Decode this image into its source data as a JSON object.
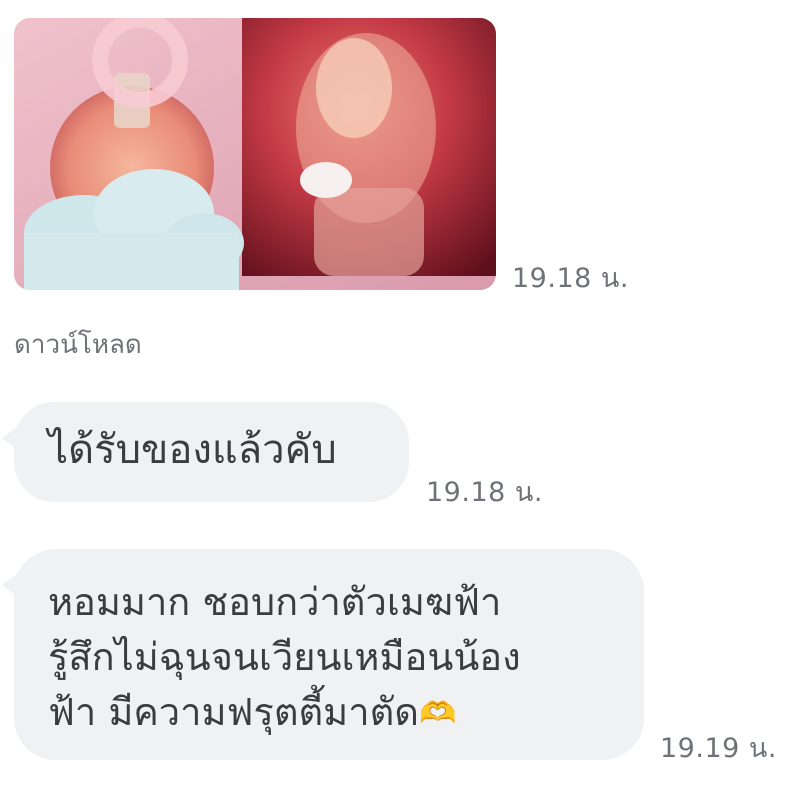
{
  "messages": [
    {
      "type": "image",
      "image_description_icon": "perfume-photo",
      "time": "19.18 น."
    },
    {
      "type": "text",
      "text": "ได้รับของแล้วคับ",
      "time": "19.18 น."
    },
    {
      "type": "text",
      "lines": [
        "หอมมาก ชอบกว่าตัวเมฆฟ้า",
        "รู้สึกไม่ฉุนจนเวียนเหมือนน้อง",
        "ฟ้า มีความฟรุตตี้มาตัด"
      ],
      "emoji": "🫶",
      "time": "19.19 น."
    }
  ],
  "download_label": "ดาวน์โหลด",
  "colors": {
    "bubble_bg": "#eff1f3",
    "text": "#3a3d40",
    "timestamp": "#6f7377",
    "image_pink": "#e9b7c4",
    "image_red": "#b5213a"
  }
}
